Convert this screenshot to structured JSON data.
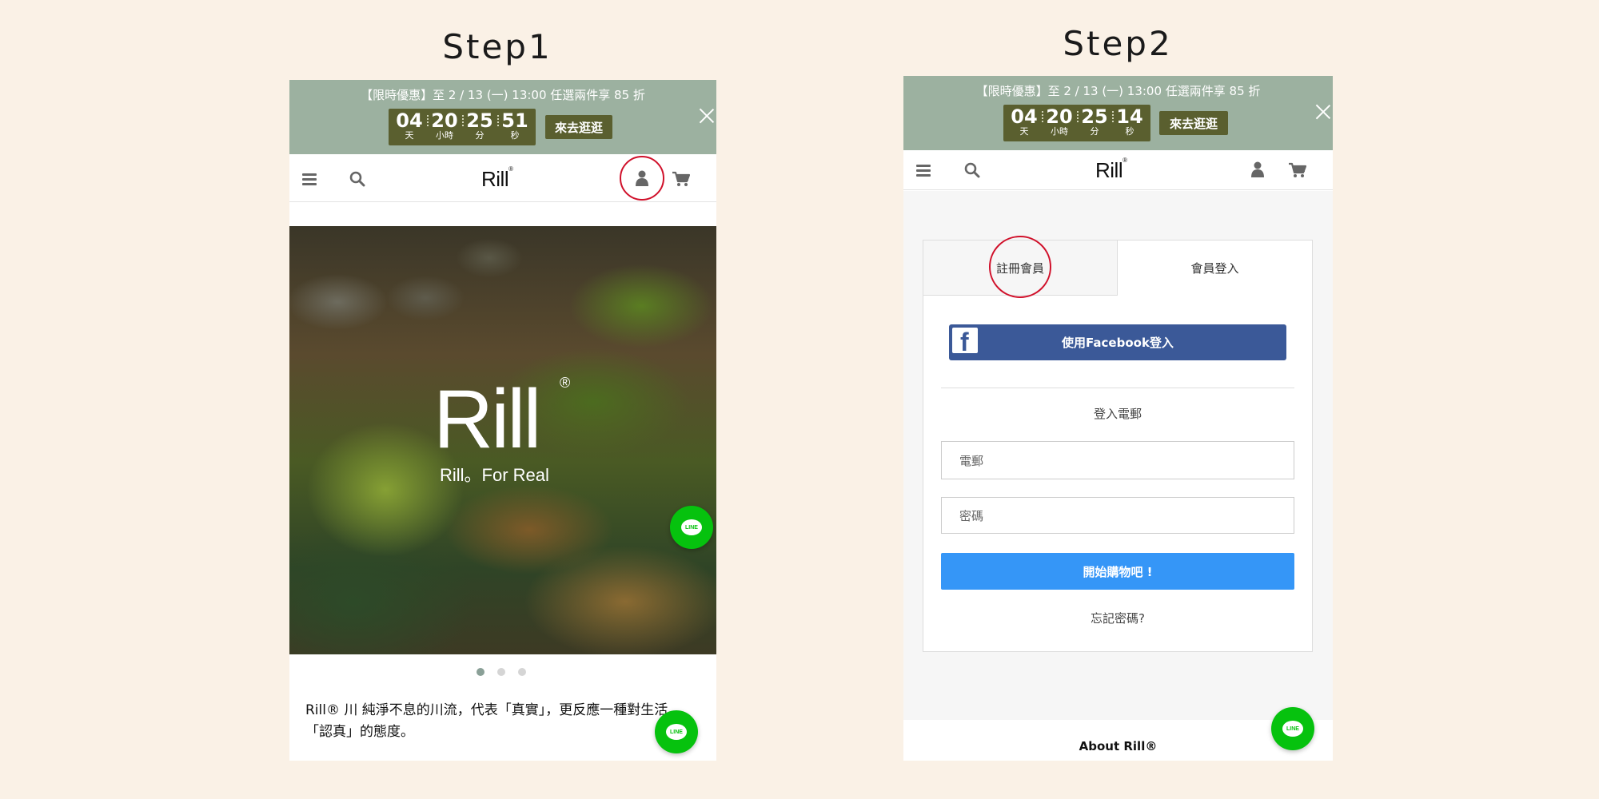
{
  "steps": {
    "step1_title": "Step1",
    "step2_title": "Step2"
  },
  "promo": {
    "text": "【限時優惠】至 2 / 13 (一) 13:00 任選兩件享 85 折",
    "button": "來去逛逛",
    "labels": {
      "days": "天",
      "hours": "小時",
      "minutes": "分",
      "seconds": "秒"
    }
  },
  "step1": {
    "countdown": {
      "days": "04",
      "hours": "20",
      "minutes": "25",
      "seconds": "51"
    },
    "hero": {
      "logo": "Rill",
      "reg": "®",
      "tagline": "Rill。For Real"
    },
    "description": "Rill® 川 純淨不息的川流，代表「真實」，更反應一種對生活「認真」的態度。",
    "carousel": {
      "total": 3,
      "active": 1
    }
  },
  "step2": {
    "countdown": {
      "days": "04",
      "hours": "20",
      "minutes": "25",
      "seconds": "14"
    },
    "tabs": {
      "register": "註冊會員",
      "login": "會員登入",
      "active": "login"
    },
    "facebook_button": "使用Facebook登入",
    "email_login_heading": "登入電郵",
    "email_placeholder": "電郵",
    "password_placeholder": "密碼",
    "submit_button": "開始購物吧 !",
    "forgot_password": "忘記密碼?",
    "footer_title": "About Rill®"
  },
  "header": {
    "logo": "Rill",
    "logo_mark": "®"
  },
  "line_button": {
    "text": "LINE"
  },
  "colors": {
    "background": "#faf1e6",
    "promo_bg": "#9cb1a0",
    "countdown_bg": "#5a5f2f",
    "highlight_circle": "#d0102a",
    "facebook": "#3b5998",
    "primary_button": "#3596f7",
    "line_green": "#06c20e"
  }
}
